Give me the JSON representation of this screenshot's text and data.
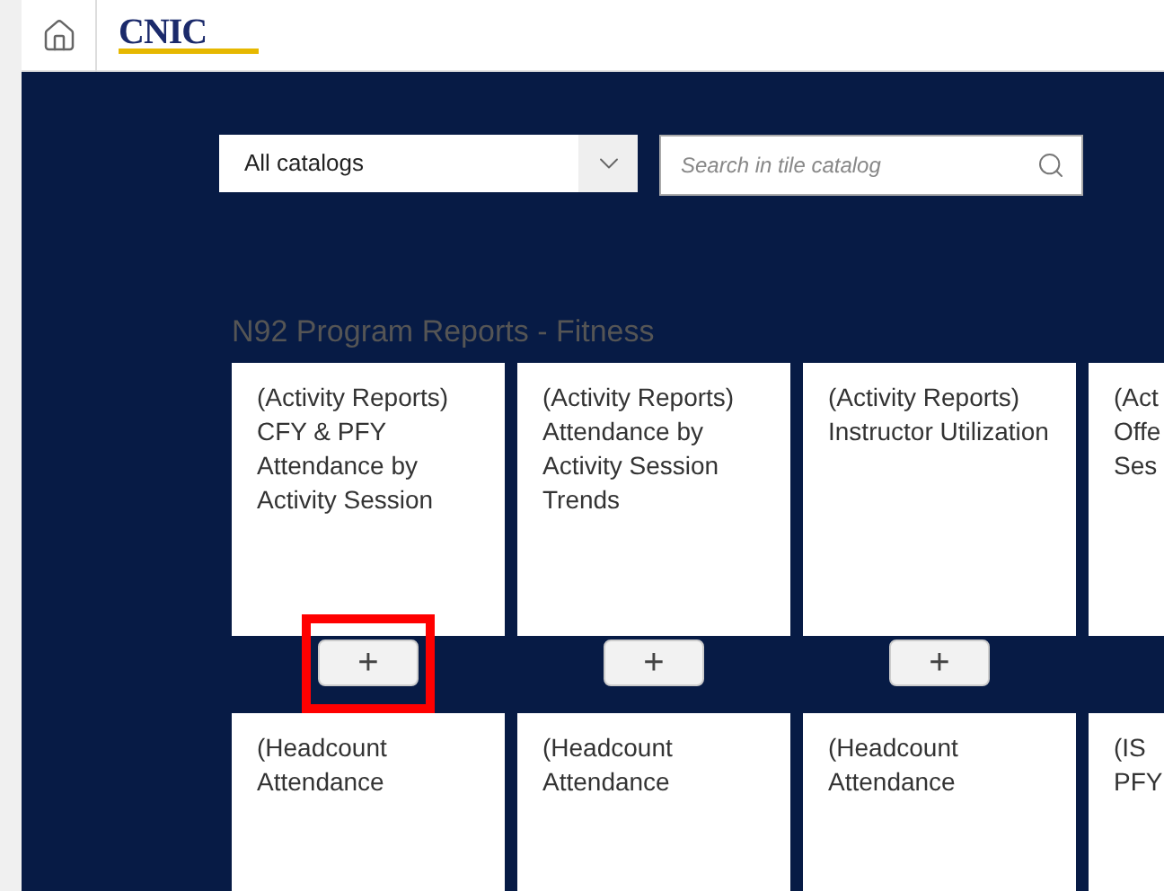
{
  "header": {
    "logo_text": "CNIC"
  },
  "catalog_select": {
    "value": "All catalogs"
  },
  "search": {
    "placeholder": "Search in tile catalog"
  },
  "group_title": "N92 Program Reports - Fitness",
  "tiles": [
    {
      "lines": [
        "(Activity Reports)",
        "CFY & PFY",
        "Attendance by",
        "Activity Session"
      ],
      "add_button": "+",
      "highlighted": true
    },
    {
      "lines": [
        "(Activity Reports)",
        "Attendance by",
        "Activity Session",
        "Trends"
      ],
      "add_button": "+",
      "highlighted": false
    },
    {
      "lines": [
        "(Activity Reports)",
        "Instructor Utilization"
      ],
      "add_button": "+",
      "highlighted": false
    },
    {
      "lines": [
        "(Act",
        "Offe",
        "Ses"
      ]
    },
    {
      "lines": [
        "(Headcount",
        "Attendance"
      ]
    },
    {
      "lines": [
        "(Headcount",
        "Attendance"
      ]
    },
    {
      "lines": [
        "(Headcount",
        "Attendance"
      ]
    },
    {
      "lines": [
        "(IS",
        "PFY"
      ]
    }
  ]
}
